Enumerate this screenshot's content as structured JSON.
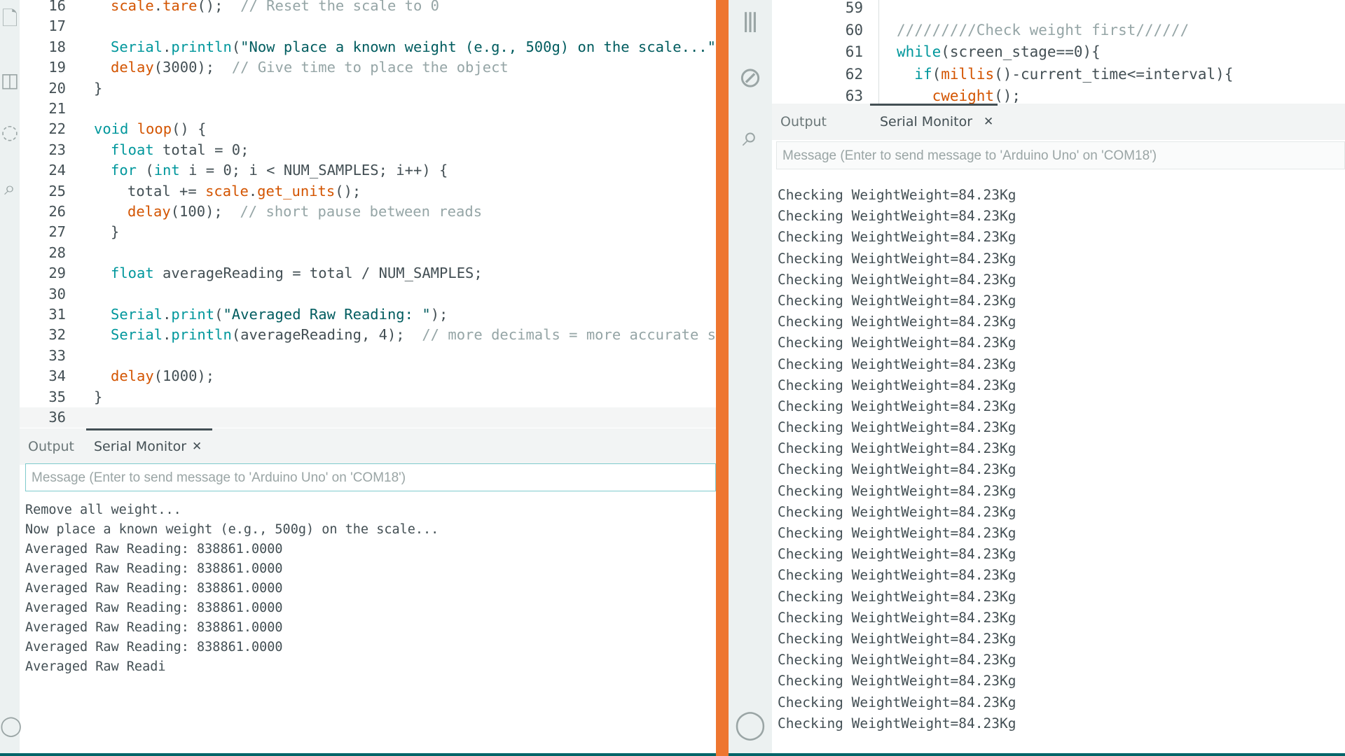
{
  "left": {
    "code_lines": [
      {
        "num": "16",
        "html": "<span class=\"fn\">scale</span>.<span class=\"fn\">tare</span>();  <span class=\"cm\">// Reset the scale to 0</span>",
        "indent": 1
      },
      {
        "num": "17",
        "html": "",
        "indent": 0
      },
      {
        "num": "18",
        "html": "<span class=\"kw\">Serial</span>.<span class=\"kw\">println</span>(<span class=\"str\">\"Now place a known weight (e.g., 500g) on the scale...\"</span>);",
        "indent": 1
      },
      {
        "num": "19",
        "html": "<span class=\"fn\">delay</span>(3000);  <span class=\"cm\">// Give time to place the object</span>",
        "indent": 1
      },
      {
        "num": "20",
        "html": "}",
        "indent": 0
      },
      {
        "num": "21",
        "html": "",
        "indent": 0
      },
      {
        "num": "22",
        "html": "<span class=\"kw\">void</span> <span class=\"fn\">loop</span>() {",
        "indent": 0
      },
      {
        "num": "23",
        "html": "<span class=\"kw\">float</span> total = 0;",
        "indent": 1
      },
      {
        "num": "24",
        "html": "<span class=\"kw\">for</span> (<span class=\"kw\">int</span> i = 0; i &lt; NUM_SAMPLES; i++) {",
        "indent": 1
      },
      {
        "num": "25",
        "html": "total += <span class=\"fn\">scale</span>.<span class=\"fn\">get_units</span>();",
        "indent": 2
      },
      {
        "num": "26",
        "html": "<span class=\"fn\">delay</span>(100);  <span class=\"cm\">// short pause between reads</span>",
        "indent": 2
      },
      {
        "num": "27",
        "html": "}",
        "indent": 1
      },
      {
        "num": "28",
        "html": "",
        "indent": 0
      },
      {
        "num": "29",
        "html": "<span class=\"kw\">float</span> averageReading = total / NUM_SAMPLES;",
        "indent": 1
      },
      {
        "num": "30",
        "html": "",
        "indent": 0
      },
      {
        "num": "31",
        "html": "<span class=\"kw\">Serial</span>.<span class=\"kw\">print</span>(<span class=\"str\">\"Averaged Raw Reading: \"</span>);",
        "indent": 1
      },
      {
        "num": "32",
        "html": "<span class=\"kw\">Serial</span>.<span class=\"kw\">println</span>(averageReading, 4);  <span class=\"cm\">// more decimals = more accurate scal</span>",
        "indent": 1
      },
      {
        "num": "33",
        "html": "",
        "indent": 0
      },
      {
        "num": "34",
        "html": "<span class=\"fn\">delay</span>(1000);",
        "indent": 1
      },
      {
        "num": "35",
        "html": "}",
        "indent": 0
      },
      {
        "num": "36",
        "html": "",
        "indent": 0
      }
    ],
    "tab_output": "Output",
    "tab_serial": "Serial Monitor",
    "tab_close": "✕",
    "message_placeholder": "Message (Enter to send message to 'Arduino Uno' on 'COM18')",
    "serial_lines": [
      "Remove all weight...",
      "Now place a known weight (e.g., 500g) on the scale...",
      "Averaged Raw Reading: 838861.0000",
      "Averaged Raw Reading: 838861.0000",
      "Averaged Raw Reading: 838861.0000",
      "Averaged Raw Reading: 838861.0000",
      "Averaged Raw Reading: 838861.0000",
      "Averaged Raw Reading: 838861.0000",
      "Averaged Raw Readi"
    ]
  },
  "right": {
    "code_lines": [
      {
        "num": "59",
        "html": ""
      },
      {
        "num": "60",
        "html": "<span class=\"cm\">/////////Check weight first//////</span>"
      },
      {
        "num": "61",
        "html": "<span class=\"kw\">while</span>(screen_stage==0){"
      },
      {
        "num": "62",
        "html": "  <span class=\"kw\">if</span>(<span class=\"fn\">millis</span>()-current_time&lt;=interval){"
      },
      {
        "num": "63",
        "html": "    <span class=\"fn\">cweight</span>();"
      }
    ],
    "tab_output": "Output",
    "tab_serial": "Serial Monitor",
    "tab_close": "✕",
    "message_placeholder": "Message (Enter to send message to 'Arduino Uno' on 'COM18')",
    "serial_line": "Checking WeightWeight=84.23Kg",
    "serial_repeat": 26
  },
  "icons": {
    "left": [
      "file-icon",
      "board-icon",
      "debug-icon",
      "search-icon",
      "account-icon"
    ],
    "right": [
      "library-icon",
      "debug-icon",
      "search-icon",
      "account-icon"
    ]
  },
  "colors": {
    "accent_orange": "#ee7630",
    "arduino_teal": "#00979c",
    "status_bar": "#006468"
  }
}
